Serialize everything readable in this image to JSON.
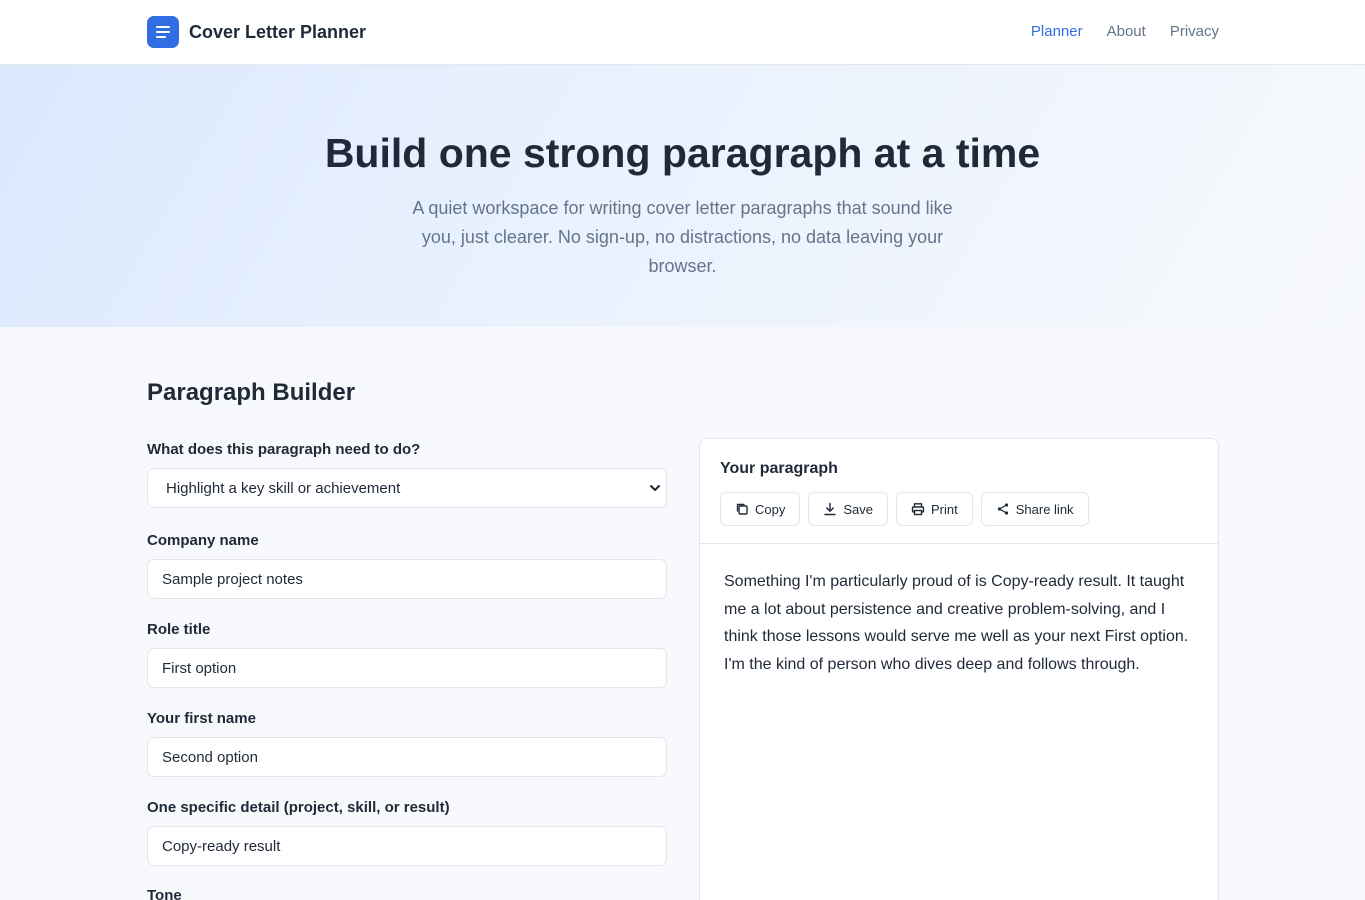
{
  "header": {
    "brand_name": "Cover Letter Planner",
    "brand_icon": "menu-lines-icon",
    "nav": [
      {
        "label": "Planner",
        "active": true
      },
      {
        "label": "About",
        "active": false
      },
      {
        "label": "Privacy",
        "active": false
      }
    ]
  },
  "hero": {
    "title": "Build one strong paragraph at a time",
    "subtitle": "A quiet workspace for writing cover letter paragraphs that sound like you, just clearer. No sign-up, no distractions, no data leaving your browser."
  },
  "builder": {
    "title": "Paragraph Builder",
    "purpose": {
      "label": "What does this paragraph need to do?",
      "value": "Highlight a key skill or achievement"
    },
    "company": {
      "label": "Company name",
      "value": "Sample project notes"
    },
    "role": {
      "label": "Role title",
      "value": "First option"
    },
    "first_name": {
      "label": "Your first name",
      "value": "Second option"
    },
    "detail": {
      "label": "One specific detail (project, skill, or result)",
      "value": "Copy-ready result"
    },
    "tone": {
      "label": "Tone"
    }
  },
  "output": {
    "title": "Your paragraph",
    "actions": {
      "copy": "Copy",
      "save": "Save",
      "print": "Print",
      "share": "Share link"
    },
    "text": "Something I'm particularly proud of is Copy-ready result. It taught me a lot about persistence and creative problem-solving, and I think those lessons would serve me well as your next First option. I'm the kind of person who dives deep and follows through."
  },
  "colors": {
    "accent": "#2f6fe3",
    "text": "#1f2937",
    "muted": "#64748b",
    "border": "#e2e6ec"
  }
}
